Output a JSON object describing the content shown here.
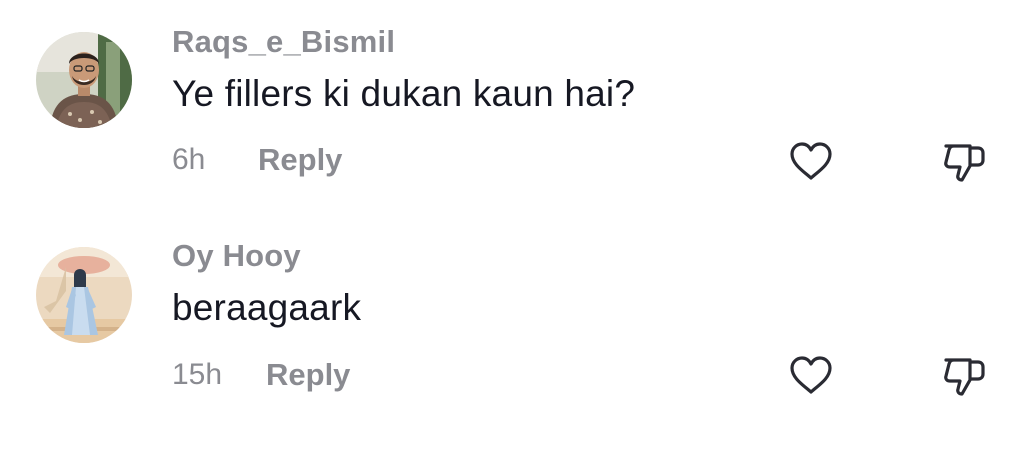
{
  "comments": [
    {
      "username": "Raqs_e_Bismil",
      "text": "Ye fillers ki dukan kaun hai?",
      "time": "6h",
      "reply_label": "Reply",
      "avatar_icon": "user-photo-avatar",
      "like_icon": "heart-outline-icon",
      "dislike_icon": "thumbs-down-outline-icon"
    },
    {
      "username": "Oy Hooy",
      "text": "beraagaark",
      "time": "15h",
      "reply_label": "Reply",
      "avatar_icon": "illustrated-figure-avatar",
      "like_icon": "heart-outline-icon",
      "dislike_icon": "thumbs-down-outline-icon"
    }
  ],
  "colors": {
    "primary_text": "#161823",
    "secondary_text": "#8a8b91",
    "icon_stroke": "#2a2b33",
    "background": "#ffffff"
  }
}
